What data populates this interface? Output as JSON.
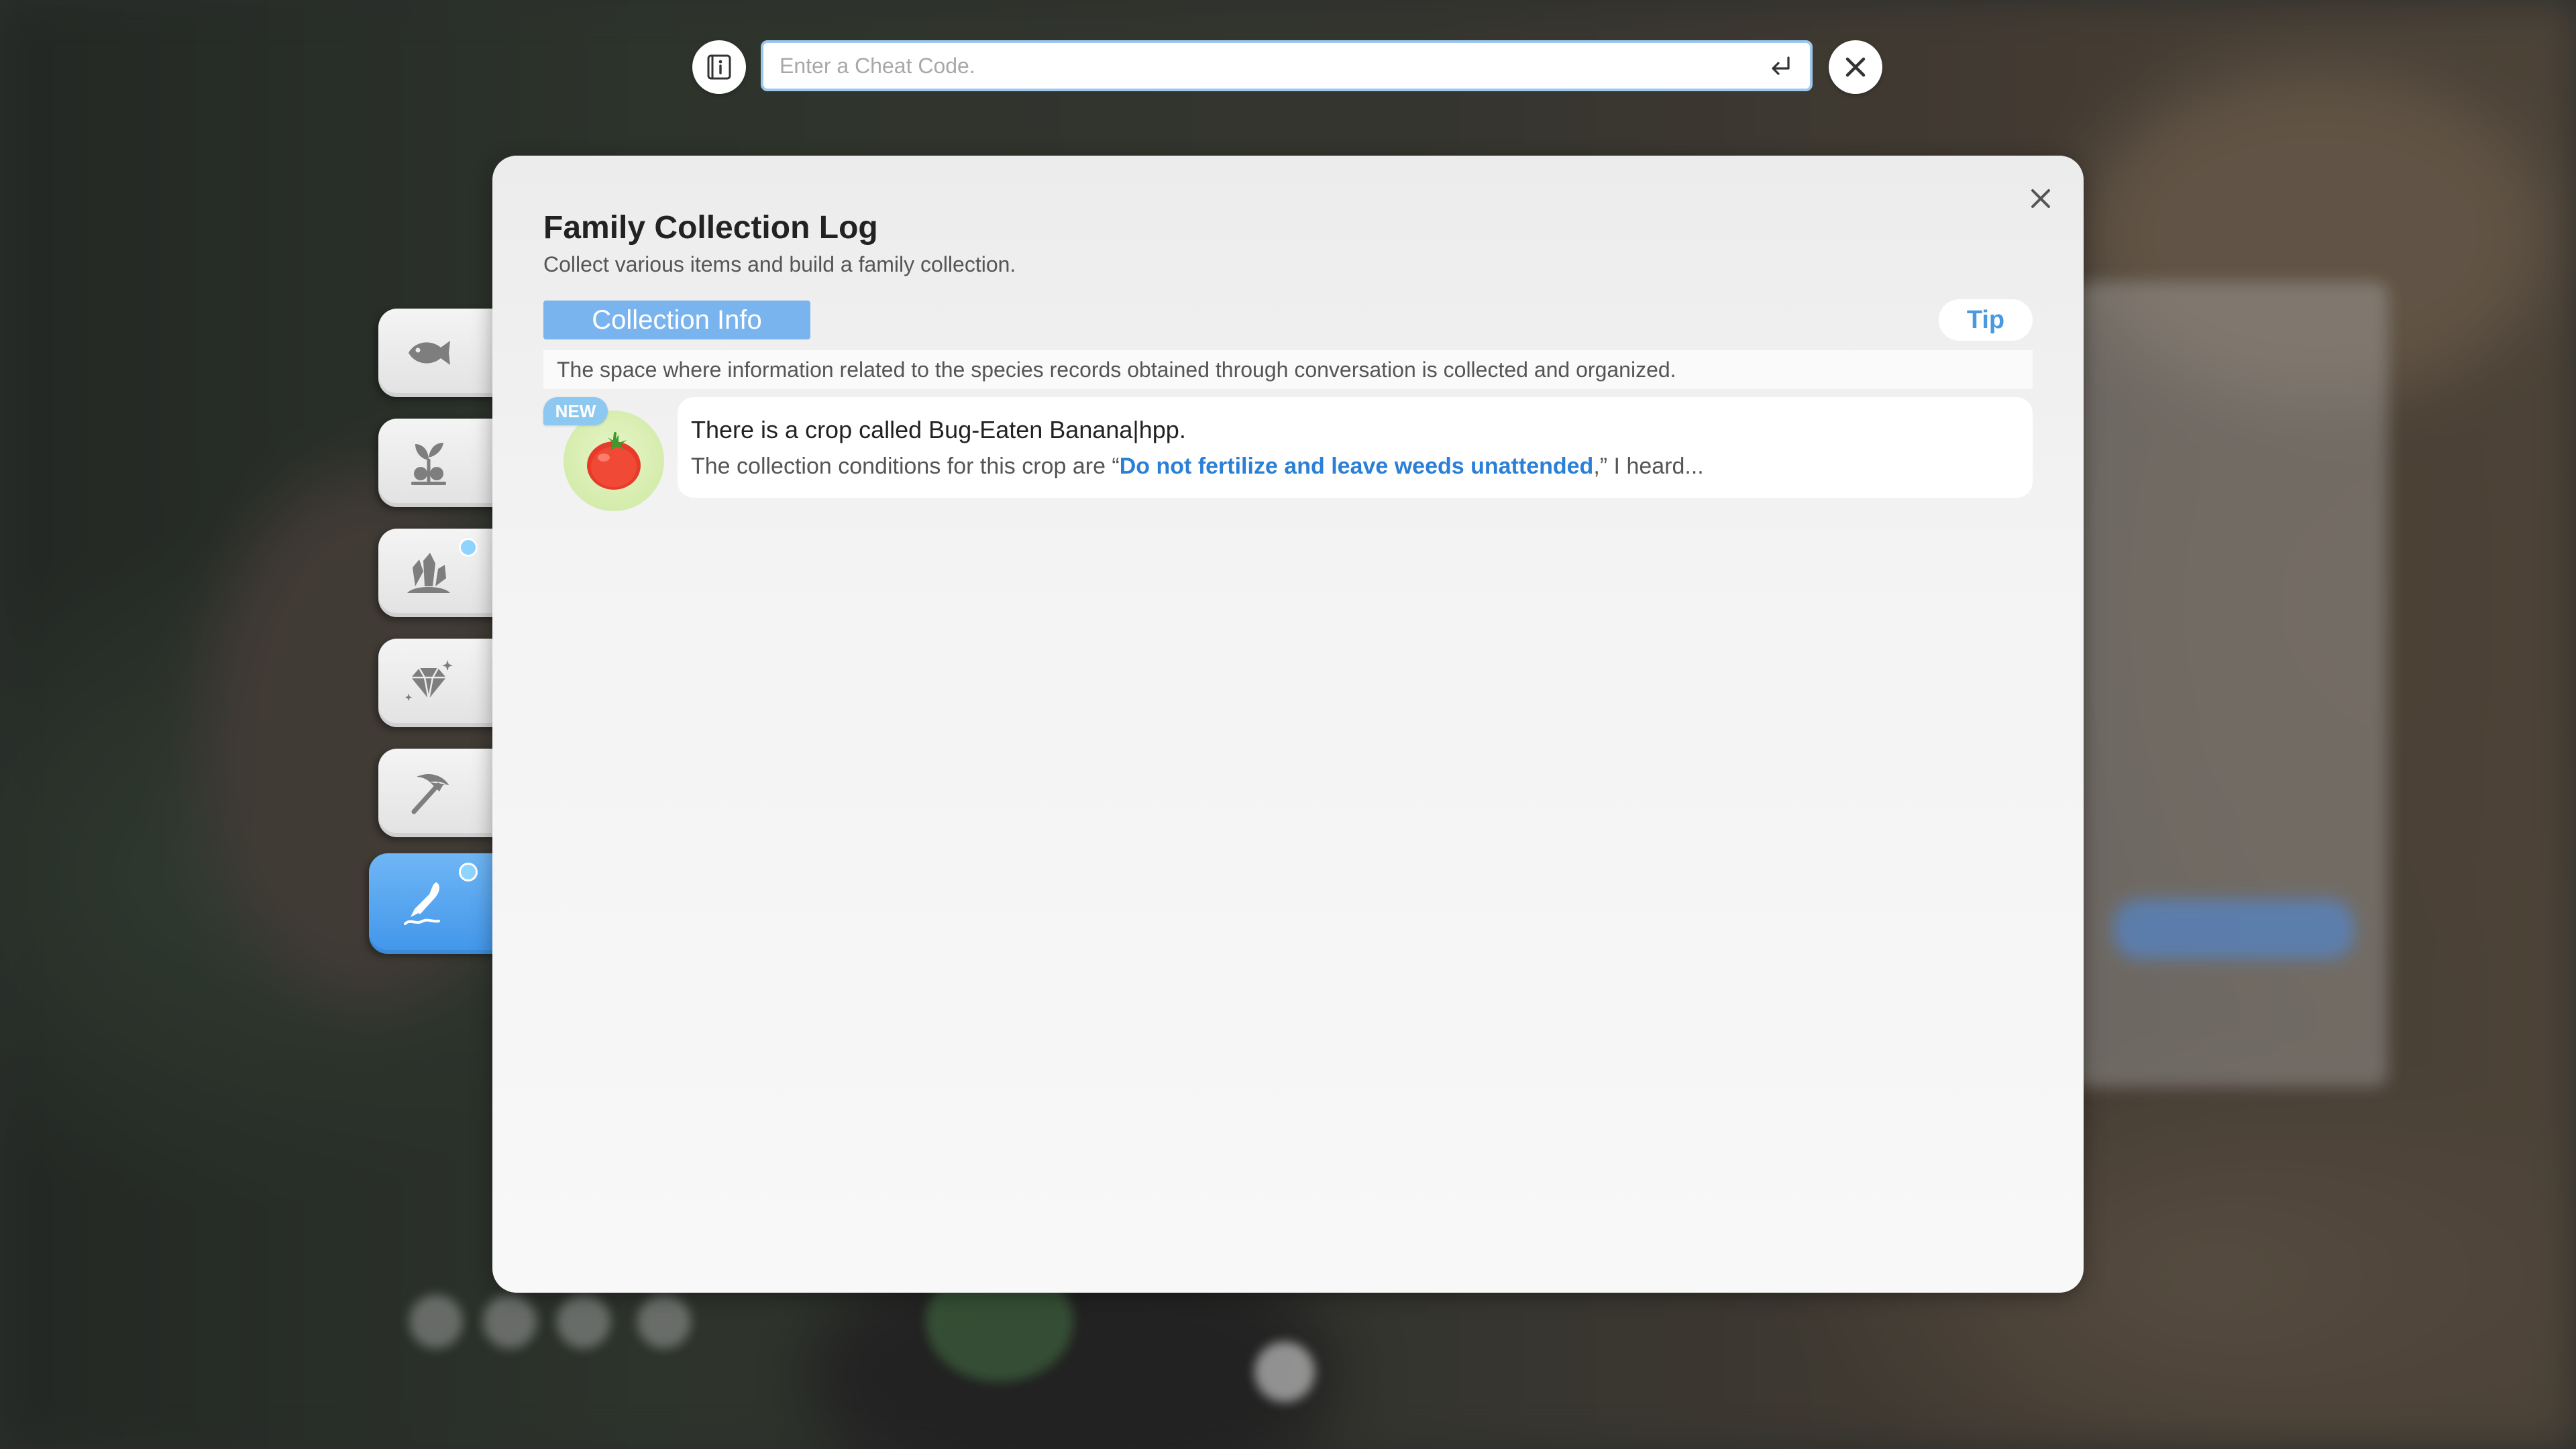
{
  "cheat_bar": {
    "placeholder": "Enter a Cheat Code.",
    "info_icon": "info-book-icon",
    "enter_icon": "return-arrow-icon",
    "close_icon": "close-icon"
  },
  "panel": {
    "title": "Family Collection Log",
    "subtitle": "Collect various items and build a family collection.",
    "close_icon": "close-icon"
  },
  "section": {
    "tab_label": "Collection Info",
    "tip_label": "Tip",
    "description": "The space where information related to the species records obtained through conversation is collected and organized."
  },
  "entry": {
    "badge": "NEW",
    "icon": "tomato-icon",
    "title": "There is a crop called Bug-Eaten Banana|hpp.",
    "desc_prefix": "The collection conditions for this crop are “",
    "desc_highlight": "Do not fertilize and leave weeds unattended",
    "desc_suffix": ",” I heard..."
  },
  "side_tabs": [
    {
      "icon": "fish-icon",
      "active": false,
      "new_dot": false
    },
    {
      "icon": "plant-icon",
      "active": false,
      "new_dot": false
    },
    {
      "icon": "ore-crystal-icon",
      "active": false,
      "new_dot": true
    },
    {
      "icon": "gem-icon",
      "active": false,
      "new_dot": false
    },
    {
      "icon": "pickaxe-icon",
      "active": false,
      "new_dot": false
    },
    {
      "icon": "quill-pen-icon",
      "active": true,
      "new_dot": true
    }
  ],
  "colors": {
    "accent": "#7ab4ee",
    "active_tab": "#4a9ced",
    "highlight_text": "#2a7fd6",
    "input_border": "#9cc8ef"
  }
}
